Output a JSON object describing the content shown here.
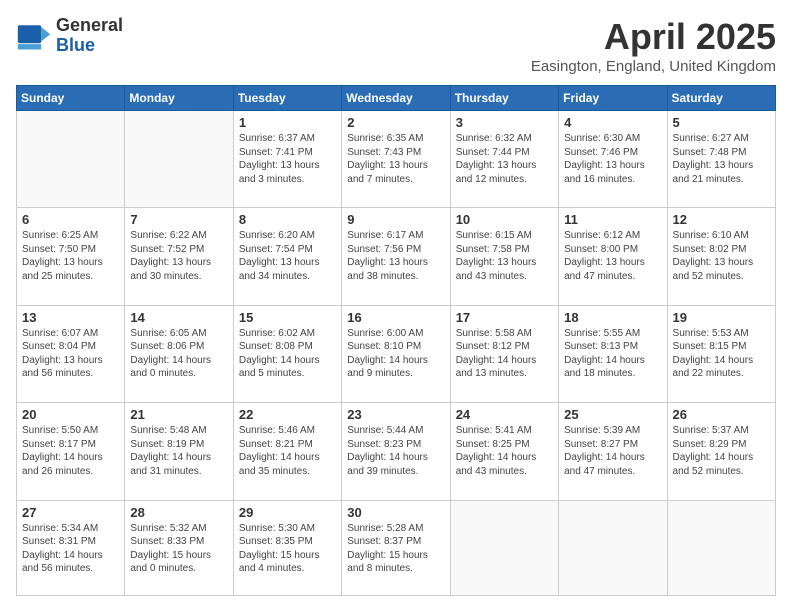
{
  "logo": {
    "general": "General",
    "blue": "Blue"
  },
  "title": {
    "month": "April 2025",
    "location": "Easington, England, United Kingdom"
  },
  "days_of_week": [
    "Sunday",
    "Monday",
    "Tuesday",
    "Wednesday",
    "Thursday",
    "Friday",
    "Saturday"
  ],
  "weeks": [
    [
      {
        "day": null
      },
      {
        "day": null
      },
      {
        "day": "1",
        "sunrise": "Sunrise: 6:37 AM",
        "sunset": "Sunset: 7:41 PM",
        "daylight": "Daylight: 13 hours and 3 minutes."
      },
      {
        "day": "2",
        "sunrise": "Sunrise: 6:35 AM",
        "sunset": "Sunset: 7:43 PM",
        "daylight": "Daylight: 13 hours and 7 minutes."
      },
      {
        "day": "3",
        "sunrise": "Sunrise: 6:32 AM",
        "sunset": "Sunset: 7:44 PM",
        "daylight": "Daylight: 13 hours and 12 minutes."
      },
      {
        "day": "4",
        "sunrise": "Sunrise: 6:30 AM",
        "sunset": "Sunset: 7:46 PM",
        "daylight": "Daylight: 13 hours and 16 minutes."
      },
      {
        "day": "5",
        "sunrise": "Sunrise: 6:27 AM",
        "sunset": "Sunset: 7:48 PM",
        "daylight": "Daylight: 13 hours and 21 minutes."
      }
    ],
    [
      {
        "day": "6",
        "sunrise": "Sunrise: 6:25 AM",
        "sunset": "Sunset: 7:50 PM",
        "daylight": "Daylight: 13 hours and 25 minutes."
      },
      {
        "day": "7",
        "sunrise": "Sunrise: 6:22 AM",
        "sunset": "Sunset: 7:52 PM",
        "daylight": "Daylight: 13 hours and 30 minutes."
      },
      {
        "day": "8",
        "sunrise": "Sunrise: 6:20 AM",
        "sunset": "Sunset: 7:54 PM",
        "daylight": "Daylight: 13 hours and 34 minutes."
      },
      {
        "day": "9",
        "sunrise": "Sunrise: 6:17 AM",
        "sunset": "Sunset: 7:56 PM",
        "daylight": "Daylight: 13 hours and 38 minutes."
      },
      {
        "day": "10",
        "sunrise": "Sunrise: 6:15 AM",
        "sunset": "Sunset: 7:58 PM",
        "daylight": "Daylight: 13 hours and 43 minutes."
      },
      {
        "day": "11",
        "sunrise": "Sunrise: 6:12 AM",
        "sunset": "Sunset: 8:00 PM",
        "daylight": "Daylight: 13 hours and 47 minutes."
      },
      {
        "day": "12",
        "sunrise": "Sunrise: 6:10 AM",
        "sunset": "Sunset: 8:02 PM",
        "daylight": "Daylight: 13 hours and 52 minutes."
      }
    ],
    [
      {
        "day": "13",
        "sunrise": "Sunrise: 6:07 AM",
        "sunset": "Sunset: 8:04 PM",
        "daylight": "Daylight: 13 hours and 56 minutes."
      },
      {
        "day": "14",
        "sunrise": "Sunrise: 6:05 AM",
        "sunset": "Sunset: 8:06 PM",
        "daylight": "Daylight: 14 hours and 0 minutes."
      },
      {
        "day": "15",
        "sunrise": "Sunrise: 6:02 AM",
        "sunset": "Sunset: 8:08 PM",
        "daylight": "Daylight: 14 hours and 5 minutes."
      },
      {
        "day": "16",
        "sunrise": "Sunrise: 6:00 AM",
        "sunset": "Sunset: 8:10 PM",
        "daylight": "Daylight: 14 hours and 9 minutes."
      },
      {
        "day": "17",
        "sunrise": "Sunrise: 5:58 AM",
        "sunset": "Sunset: 8:12 PM",
        "daylight": "Daylight: 14 hours and 13 minutes."
      },
      {
        "day": "18",
        "sunrise": "Sunrise: 5:55 AM",
        "sunset": "Sunset: 8:13 PM",
        "daylight": "Daylight: 14 hours and 18 minutes."
      },
      {
        "day": "19",
        "sunrise": "Sunrise: 5:53 AM",
        "sunset": "Sunset: 8:15 PM",
        "daylight": "Daylight: 14 hours and 22 minutes."
      }
    ],
    [
      {
        "day": "20",
        "sunrise": "Sunrise: 5:50 AM",
        "sunset": "Sunset: 8:17 PM",
        "daylight": "Daylight: 14 hours and 26 minutes."
      },
      {
        "day": "21",
        "sunrise": "Sunrise: 5:48 AM",
        "sunset": "Sunset: 8:19 PM",
        "daylight": "Daylight: 14 hours and 31 minutes."
      },
      {
        "day": "22",
        "sunrise": "Sunrise: 5:46 AM",
        "sunset": "Sunset: 8:21 PM",
        "daylight": "Daylight: 14 hours and 35 minutes."
      },
      {
        "day": "23",
        "sunrise": "Sunrise: 5:44 AM",
        "sunset": "Sunset: 8:23 PM",
        "daylight": "Daylight: 14 hours and 39 minutes."
      },
      {
        "day": "24",
        "sunrise": "Sunrise: 5:41 AM",
        "sunset": "Sunset: 8:25 PM",
        "daylight": "Daylight: 14 hours and 43 minutes."
      },
      {
        "day": "25",
        "sunrise": "Sunrise: 5:39 AM",
        "sunset": "Sunset: 8:27 PM",
        "daylight": "Daylight: 14 hours and 47 minutes."
      },
      {
        "day": "26",
        "sunrise": "Sunrise: 5:37 AM",
        "sunset": "Sunset: 8:29 PM",
        "daylight": "Daylight: 14 hours and 52 minutes."
      }
    ],
    [
      {
        "day": "27",
        "sunrise": "Sunrise: 5:34 AM",
        "sunset": "Sunset: 8:31 PM",
        "daylight": "Daylight: 14 hours and 56 minutes."
      },
      {
        "day": "28",
        "sunrise": "Sunrise: 5:32 AM",
        "sunset": "Sunset: 8:33 PM",
        "daylight": "Daylight: 15 hours and 0 minutes."
      },
      {
        "day": "29",
        "sunrise": "Sunrise: 5:30 AM",
        "sunset": "Sunset: 8:35 PM",
        "daylight": "Daylight: 15 hours and 4 minutes."
      },
      {
        "day": "30",
        "sunrise": "Sunrise: 5:28 AM",
        "sunset": "Sunset: 8:37 PM",
        "daylight": "Daylight: 15 hours and 8 minutes."
      },
      {
        "day": null
      },
      {
        "day": null
      },
      {
        "day": null
      }
    ]
  ]
}
